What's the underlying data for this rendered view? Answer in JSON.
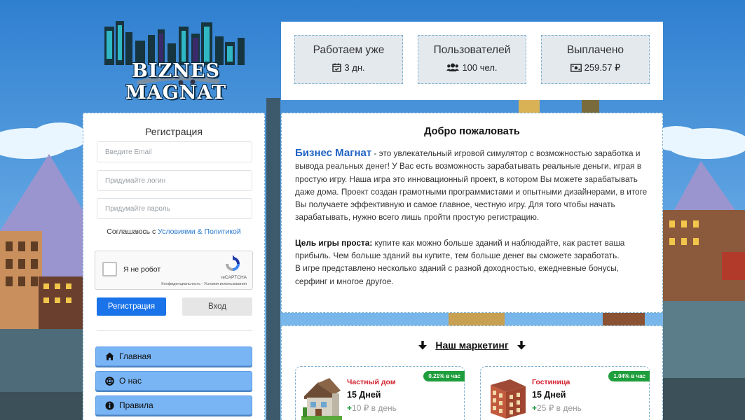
{
  "logo": {
    "text": "BIZNES MAGNAT"
  },
  "stats": [
    {
      "label": "Работаем уже",
      "value": "3 дн.",
      "icon": "calendar-check-icon"
    },
    {
      "label": "Пользователей",
      "value": "100 чел.",
      "icon": "users-icon"
    },
    {
      "label": "Выплачено",
      "value": "259.57 ₽",
      "icon": "money-bill-icon"
    }
  ],
  "registration": {
    "title": "Регистрация",
    "email_placeholder": "Введите Email",
    "login_placeholder": "Придумайте логин",
    "password_placeholder": "Придумайте пароль",
    "agree_text": "Соглашаюсь с ",
    "agree_link": "Условиями & Политикой",
    "captcha_label": "Я не робот",
    "captcha_brand": "reCAPTCHA",
    "captcha_privacy": "Конфиденциальность - Условия использования",
    "register_button": "Регистрация",
    "login_button": "Вход"
  },
  "nav": [
    {
      "label": "Главная",
      "icon": "home-icon"
    },
    {
      "label": "О нас",
      "icon": "lifebuoy-icon"
    },
    {
      "label": "Правила",
      "icon": "info-circle-icon"
    }
  ],
  "welcome": {
    "title": "Добро пожаловать",
    "brand": "Бизнес Магнат",
    "intro": " - это увлекательный игровой симулятор с возможностью заработка и вывода реальных денег! У Вас есть возможность зарабатывать реальные деньги, играя в простую игру. Наша игра это инновационный проект, в котором Вы можете зарабатывать даже дома. Проект создан грамотными программистами и опытными дизайнерами, в итоге Вы получаете эффективную и самое главное, честную игру. Для того чтобы начать зарабатывать, нужно всего лишь пройти простую регистрацию.",
    "goal_label": "Цель игры проста:",
    "goal_text": " купите как можно больше зданий и наблюдайте, как растет ваша прибыль. Чем больше зданий вы купите, тем больше денег вы сможете заработать.",
    "extra_text": "В игре представлено несколько зданий с разной доходностью, ежедневные бонусы, серфинг и многое другое."
  },
  "marketing": {
    "title": "Наш маркетинг",
    "cards": [
      {
        "name": "Частный дом",
        "days": "15 Дней",
        "income": "10 ₽ в день",
        "badge": "0.21% в час"
      },
      {
        "name": "Гостиница",
        "days": "15 Дней",
        "income": "25 ₽ в день",
        "badge": "1.04% в час"
      }
    ]
  },
  "colors": {
    "accent": "#1a73e8",
    "nav_button": "#79b4f5",
    "brand_blue": "#1e62c4",
    "card_name_red": "#d3202e",
    "badge_green": "#1e9e3c"
  }
}
